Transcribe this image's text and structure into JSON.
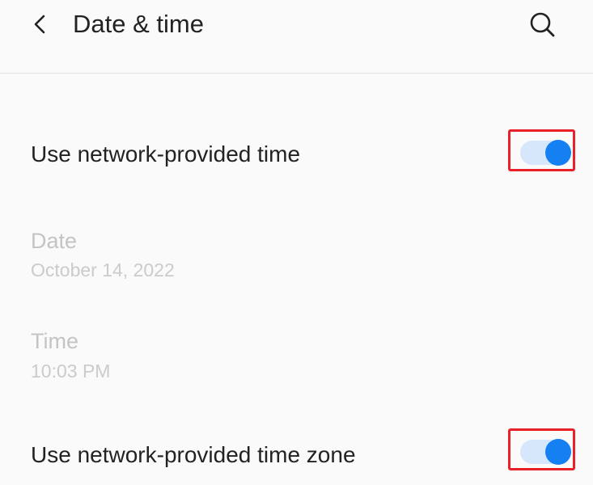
{
  "header": {
    "title": "Date & time",
    "back_icon": "chevron-left-icon",
    "search_icon": "search-icon"
  },
  "settings": {
    "network_time": {
      "label": "Use network-provided time",
      "enabled": true
    },
    "date": {
      "title": "Date",
      "value": "October 14, 2022"
    },
    "time": {
      "title": "Time",
      "value": "10:03 PM"
    },
    "network_time_zone": {
      "label": "Use network-provided time zone",
      "enabled": true
    }
  },
  "colors": {
    "accent": "#1480f2",
    "track": "#d6e7fb",
    "highlight": "#e8212a",
    "background": "#fafafa"
  }
}
